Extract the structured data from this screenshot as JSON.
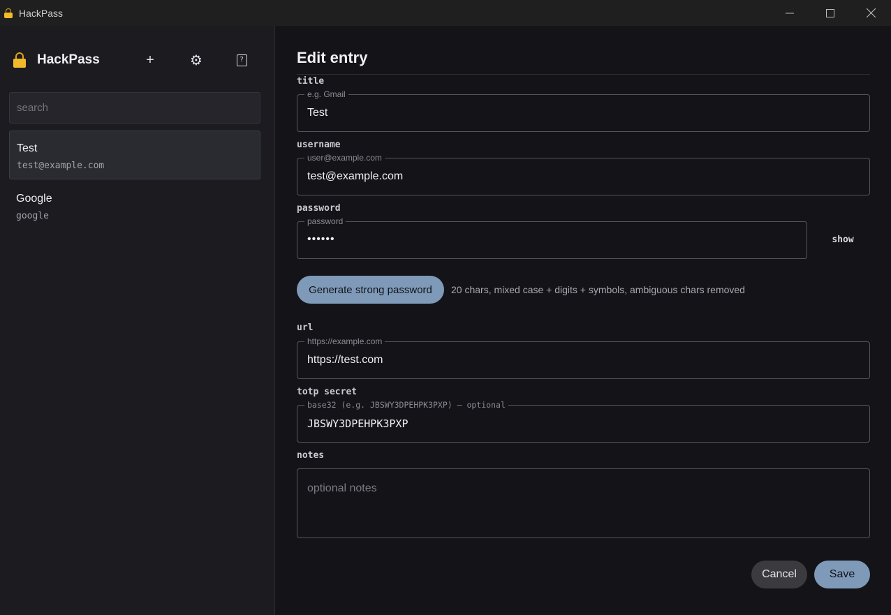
{
  "window": {
    "title": "HackPass",
    "controls": {
      "minimize": "—",
      "maximize": "☐",
      "close": "✕"
    }
  },
  "sidebar": {
    "brand": "HackPass",
    "buttons": {
      "add": "+",
      "settings": "⚙",
      "lock": "?"
    },
    "search": {
      "placeholder": "search",
      "value": ""
    },
    "entries": [
      {
        "title": "Test",
        "subtitle": "test@example.com",
        "selected": true
      },
      {
        "title": "Google",
        "subtitle": "google",
        "selected": false
      }
    ]
  },
  "editor": {
    "heading": "Edit entry",
    "fields": {
      "title": {
        "label": "title",
        "hint": "e.g. Gmail",
        "value": "Test"
      },
      "username": {
        "label": "username",
        "hint": "user@example.com",
        "value": "test@example.com"
      },
      "password": {
        "label": "password",
        "hint": "password",
        "value": "••••••",
        "toggle": "show"
      },
      "url": {
        "label": "url",
        "hint": "https://example.com",
        "value": "https://test.com"
      },
      "totp": {
        "label": "totp secret",
        "hint": "base32 (e.g. JBSWY3DPEHPK3PXP) — optional",
        "value": "JBSWY3DPEHPK3PXP"
      },
      "notes": {
        "label": "notes",
        "placeholder": "optional notes",
        "value": ""
      }
    },
    "generate": {
      "label": "Generate strong password",
      "hint": "20 chars, mixed case + digits + symbols, ambiguous chars removed"
    },
    "actions": {
      "cancel": "Cancel",
      "save": "Save"
    }
  },
  "colors": {
    "accent": "#7f9ab8",
    "lock_icon": "#f2b92a",
    "background": "#141418",
    "sidebar": "#1b1b20"
  },
  "icons": {
    "app": "lock-icon",
    "add": "plus-icon",
    "settings": "gear-icon",
    "lock": "key-box-icon"
  }
}
